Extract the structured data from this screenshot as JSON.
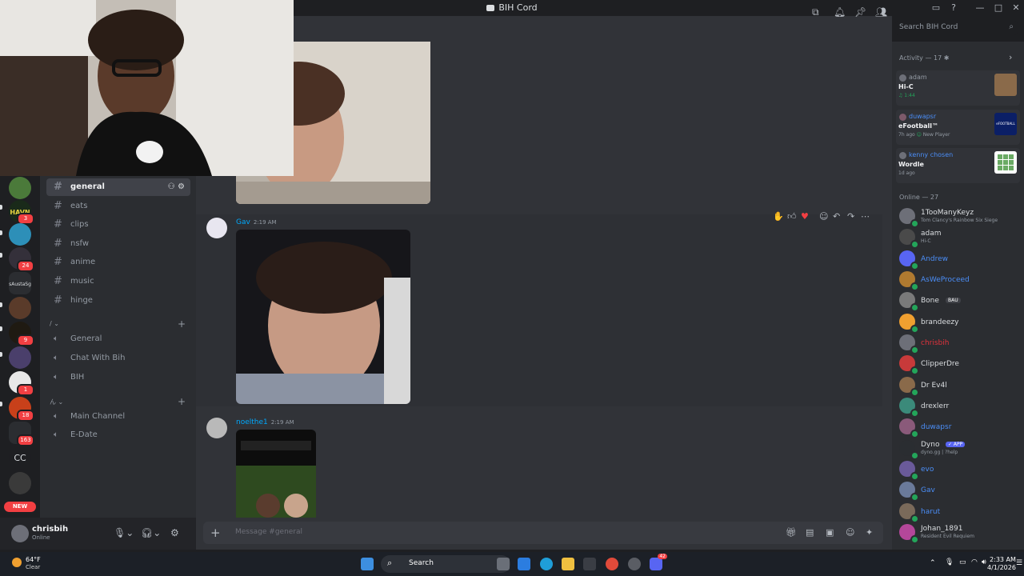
{
  "window": {
    "title": "BIH Cord"
  },
  "channels": {
    "text": [
      {
        "name": "general",
        "active": true
      },
      {
        "name": "eats"
      },
      {
        "name": "clips"
      },
      {
        "name": "nsfw"
      },
      {
        "name": "anime"
      },
      {
        "name": "music"
      },
      {
        "name": "hinge"
      }
    ],
    "voice_cat_1": {
      "label": "/ ⌄",
      "items": [
        "General",
        "Chat With Bih",
        "BIH"
      ]
    },
    "voice_cat_2": {
      "label": "ん ⌄",
      "items": [
        "Main Channel",
        "E-Date"
      ]
    }
  },
  "guilds": {
    "badges": [
      "3",
      "24",
      "9",
      "1",
      "18",
      "163"
    ],
    "cc_label": "CC",
    "new_label": "NEW",
    "scribble_label": "sAustaSg"
  },
  "user": {
    "name": "chrisbih",
    "status": "Online"
  },
  "search": {
    "placeholder": "Search BIH Cord"
  },
  "messages": [
    {
      "author": "Gav",
      "time": "2:19 AM"
    },
    {
      "author": "noelthe1",
      "time": "2:19 AM"
    }
  ],
  "composer": {
    "placeholder": "Message #general"
  },
  "activity": {
    "title": "Activity — 17 ✱",
    "items": [
      {
        "user": "adam",
        "game": "Hi-C",
        "meta": "♫ 1:44"
      },
      {
        "user": "duwapsr",
        "game": "eFootball™",
        "meta": "7h ago",
        "extra": "New Player",
        "thumb_text": "eFOOTBALL"
      },
      {
        "user": "kenny chosen",
        "game": "Wordle",
        "meta": "1d ago"
      }
    ]
  },
  "online": {
    "title": "Online — 27",
    "members": [
      {
        "name": "1TooManyKeyz",
        "sub": "Tom Clancy's Rainbow Six Siege",
        "color": "#dbdee1"
      },
      {
        "name": "adam",
        "sub": "Hi-C",
        "color": "#dbdee1"
      },
      {
        "name": "Andrew",
        "sub": "",
        "color": "#4b8ef7"
      },
      {
        "name": "AsWeProceed",
        "sub": "",
        "color": "#4b8ef7"
      },
      {
        "name": "Bone",
        "sub": "",
        "color": "#dbdee1",
        "tag": "BAU"
      },
      {
        "name": "brandeezy",
        "sub": "",
        "color": "#dbdee1"
      },
      {
        "name": "chrisbih",
        "sub": "",
        "color": "#e0323c"
      },
      {
        "name": "ClipperDre",
        "sub": "",
        "color": "#dbdee1"
      },
      {
        "name": "Dr Ev4l",
        "sub": "",
        "color": "#dbdee1"
      },
      {
        "name": "drexlerr",
        "sub": "",
        "color": "#dbdee1"
      },
      {
        "name": "duwapsr",
        "sub": "",
        "color": "#4b8ef7"
      },
      {
        "name": "Dyno",
        "sub": "dyno.gg | ?help",
        "color": "#dbdee1",
        "tag": "✓ APP"
      },
      {
        "name": "evo",
        "sub": "",
        "color": "#4b8ef7"
      },
      {
        "name": "Gav",
        "sub": "",
        "color": "#4b8ef7"
      },
      {
        "name": "harut",
        "sub": "",
        "color": "#4b8ef7"
      },
      {
        "name": "Johan_1891",
        "sub": "Resident Evil Requiem",
        "color": "#dbdee1"
      }
    ]
  },
  "taskbar": {
    "temperature": "64°F",
    "condition": "Clear",
    "search_label": "Search",
    "time": "2:33 AM",
    "date": "4/1/2026",
    "discord_badge": "42"
  },
  "colors": {
    "accent": "#5865f2",
    "online": "#23a55a",
    "link": "#00a8fc"
  }
}
